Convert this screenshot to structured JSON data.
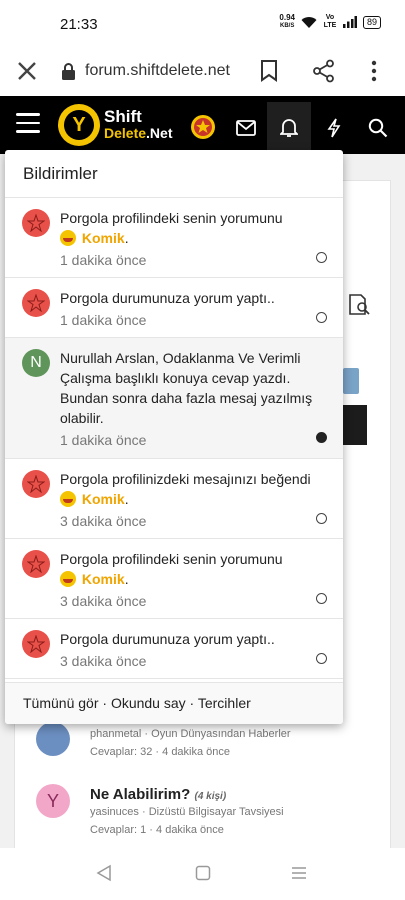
{
  "status": {
    "time": "21:33",
    "net_speed": "0.94",
    "net_unit": "KB/S",
    "volte": "Vo LTE",
    "battery": "89"
  },
  "browser": {
    "url": "forum.shiftdelete.net"
  },
  "site": {
    "logo_line1": "Shift",
    "logo_line2a": "Delete",
    "logo_line2b": ".Net"
  },
  "dropdown": {
    "title": "Bildirimler",
    "notifications": [
      {
        "avatar": "",
        "text": "Porgola profilindeki senin yorumunu",
        "reaction": "Komik",
        "time": "1 dakika önce",
        "read": true
      },
      {
        "avatar": "",
        "text": "Porgola durumunuza yorum yaptı..",
        "reaction": "",
        "time": "1 dakika önce",
        "read": true
      },
      {
        "avatar": "N",
        "text": "Nurullah Arslan, Odaklanma Ve Verimli Çalışma başlıklı konuya cevap yazdı. Bundan sonra daha fazla mesaj yazılmış olabilir.",
        "reaction": "",
        "time": "1 dakika önce",
        "read": false
      },
      {
        "avatar": "",
        "text": "Porgola profilinizdeki mesajınızı beğendi",
        "reaction": "Komik",
        "time": "3 dakika önce",
        "read": true
      },
      {
        "avatar": "",
        "text": "Porgola profilindeki senin yorumunu",
        "reaction": "Komik",
        "time": "3 dakika önce",
        "read": true
      },
      {
        "avatar": "",
        "text": "Porgola durumunuza yorum yaptı..",
        "reaction": "",
        "time": "3 dakika önce",
        "read": true
      }
    ],
    "footer": {
      "see_all": "Tümünü gör",
      "sep1": " · ",
      "mark_read": "Okundu say",
      "sep2": " · ",
      "preferences": "Tercihler"
    }
  },
  "background_threads": [
    {
      "avatar": "",
      "title": "",
      "tag": "",
      "meta": "phanmetal · Oyun Dünyasından Haberler",
      "replies": "Cevaplar: 32 · 4 dakika önce"
    },
    {
      "avatar": "Y",
      "title": "Ne Alabilirim?",
      "tag": "(4 kişi)",
      "meta": "yasinuces · Dizüstü Bilgisayar Tavsiyesi",
      "replies": "Cevaplar: 1 · 4 dakika önce"
    }
  ],
  "colors": {
    "header_bg": "#000000",
    "brand_yellow": "#f5c400",
    "reaction": "#f0a500",
    "avatar_red": "#e8504a",
    "avatar_green": "#5f955a",
    "avatar_pink": "#f2a7c9"
  }
}
